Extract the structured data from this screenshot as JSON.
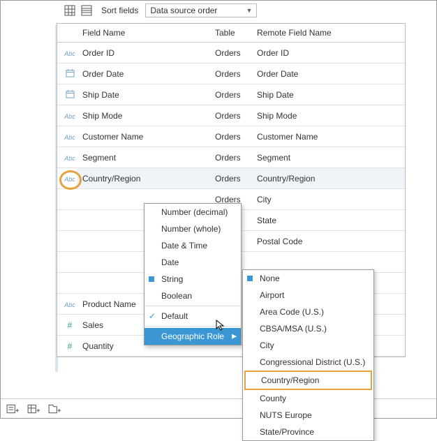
{
  "toolbar": {
    "sort_label": "Sort fields",
    "sort_value": "Data source order"
  },
  "columns": {
    "field_name": "Field Name",
    "table": "Table",
    "remote": "Remote Field Name"
  },
  "rows": [
    {
      "type": "abc",
      "name": "Order ID",
      "table": "Orders",
      "remote": "Order ID"
    },
    {
      "type": "date",
      "name": "Order Date",
      "table": "Orders",
      "remote": "Order Date"
    },
    {
      "type": "date",
      "name": "Ship Date",
      "table": "Orders",
      "remote": "Ship Date"
    },
    {
      "type": "abc",
      "name": "Ship Mode",
      "table": "Orders",
      "remote": "Ship Mode"
    },
    {
      "type": "abc",
      "name": "Customer Name",
      "table": "Orders",
      "remote": "Customer Name"
    },
    {
      "type": "abc",
      "name": "Segment",
      "table": "Orders",
      "remote": "Segment"
    },
    {
      "type": "abc",
      "name": "Country/Region",
      "table": "Orders",
      "remote": "Country/Region",
      "highlight": true
    },
    {
      "type": "",
      "name": "",
      "table": "Orders",
      "remote": "City"
    },
    {
      "type": "",
      "name": "",
      "table": "Orders",
      "remote": "State"
    },
    {
      "type": "",
      "name": "",
      "table": "Orders",
      "remote": "Postal Code"
    },
    {
      "type": "",
      "name": "",
      "table": "",
      "remote": ""
    },
    {
      "type": "",
      "name": "",
      "table": "",
      "remote": ""
    },
    {
      "type": "abc",
      "name": "Product Name",
      "table": "",
      "remote": ""
    },
    {
      "type": "hash",
      "name": "Sales",
      "table": "",
      "remote": ""
    },
    {
      "type": "hash",
      "name": "Quantity",
      "table": "",
      "remote": ""
    }
  ],
  "type_menu": {
    "items": [
      {
        "label": "Number (decimal)"
      },
      {
        "label": "Number (whole)"
      },
      {
        "label": "Date & Time"
      },
      {
        "label": "Date"
      },
      {
        "label": "String",
        "selected": true
      },
      {
        "label": "Boolean"
      }
    ],
    "default": "Default",
    "geo": "Geographic Role"
  },
  "geo_menu": {
    "items": [
      "None",
      "Airport",
      "Area Code (U.S.)",
      "CBSA/MSA (U.S.)",
      "City",
      "Congressional District (U.S.)",
      "Country/Region",
      "County",
      "NUTS Europe",
      "State/Province"
    ],
    "selected_index": 0,
    "highlighted_index": 6
  }
}
